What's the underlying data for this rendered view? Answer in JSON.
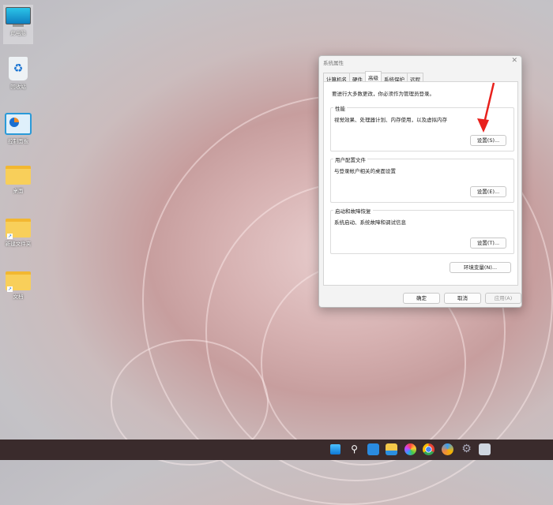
{
  "desktop": {
    "icons": [
      {
        "label": "此电脑",
        "icon": "computer-icon"
      },
      {
        "label": "回收站",
        "icon": "recycle-bin-icon"
      },
      {
        "label": "控制面板",
        "icon": "control-panel-icon"
      },
      {
        "label": "桌面",
        "icon": "folder-icon"
      },
      {
        "label": "新建文件夹",
        "icon": "folder-shortcut-icon"
      },
      {
        "label": "文档",
        "icon": "folder-shortcut-icon"
      }
    ]
  },
  "dialog": {
    "title": "系统属性",
    "tabs": [
      "计算机名",
      "硬件",
      "高级",
      "系统保护",
      "远程"
    ],
    "active_tab": "高级",
    "admin_note": "要进行大多数更改，你必须作为管理员登录。",
    "performance": {
      "title": "性能",
      "desc": "视觉效果、处理器计划、内存使用，以及虚拟内存",
      "button": "设置(S)..."
    },
    "profiles": {
      "title": "用户配置文件",
      "desc": "与登录帐户相关的桌面设置",
      "button": "设置(E)..."
    },
    "startup": {
      "title": "启动和故障恢复",
      "desc": "系统启动、系统故障和调试信息",
      "button": "设置(T)..."
    },
    "env_button": "环境变量(N)...",
    "ok": "确定",
    "cancel": "取消",
    "apply": "应用(A)"
  },
  "taskbar": {
    "icons": [
      "start-icon",
      "search-icon",
      "widgets-icon",
      "file-explorer-icon",
      "photos-icon",
      "chrome-icon",
      "paint-icon",
      "settings-icon",
      "system-icon"
    ]
  },
  "colors": {
    "arrow": "#e8201c",
    "taskbar": "#3a2b2c"
  }
}
